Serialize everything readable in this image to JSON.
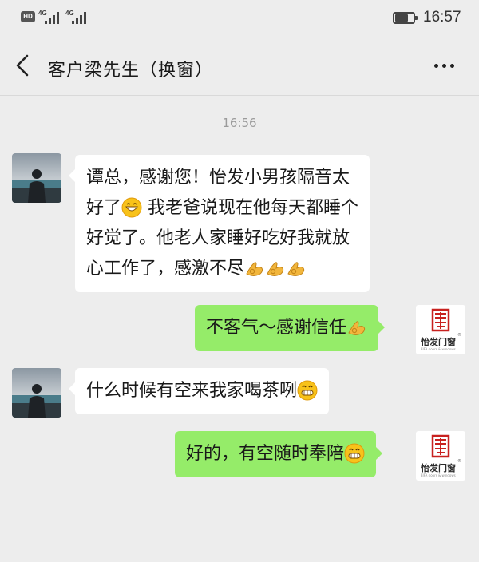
{
  "status_bar": {
    "hd_badge": "HD",
    "network_1": "4G",
    "network_2": "4G",
    "battery_level": 0.72,
    "time": "16:57"
  },
  "header": {
    "back_icon": "chevron-left-icon",
    "title": "客户梁先生（换窗）",
    "more_icon": "more-dots-icon"
  },
  "chat": {
    "timestamp": "16:56",
    "messages": [
      {
        "side": "incoming",
        "lines": [
          "谭总，感谢您！怡发小男孩隔音太",
          "好了",
          "我老爸说现在他每天都睡个",
          "好觉了。他老人家睡好吃好我就放",
          "心工作了，感激不尽"
        ]
      },
      {
        "side": "outgoing",
        "text": "不客气～感谢信任"
      },
      {
        "side": "incoming",
        "text": "什么时候有空来我家喝茶咧"
      },
      {
        "side": "outgoing",
        "text": "好的，有空随时奉陪"
      }
    ],
    "self_avatar": {
      "brand_text": "怡发门窗",
      "registered_mark": "®",
      "sub_text": "EIFA doors & windows"
    }
  },
  "colors": {
    "background": "#ededed",
    "incoming_bubble": "#ffffff",
    "outgoing_bubble": "#95ec69",
    "timestamp_text": "#9b9b9b",
    "brand_red": "#c8211f"
  }
}
